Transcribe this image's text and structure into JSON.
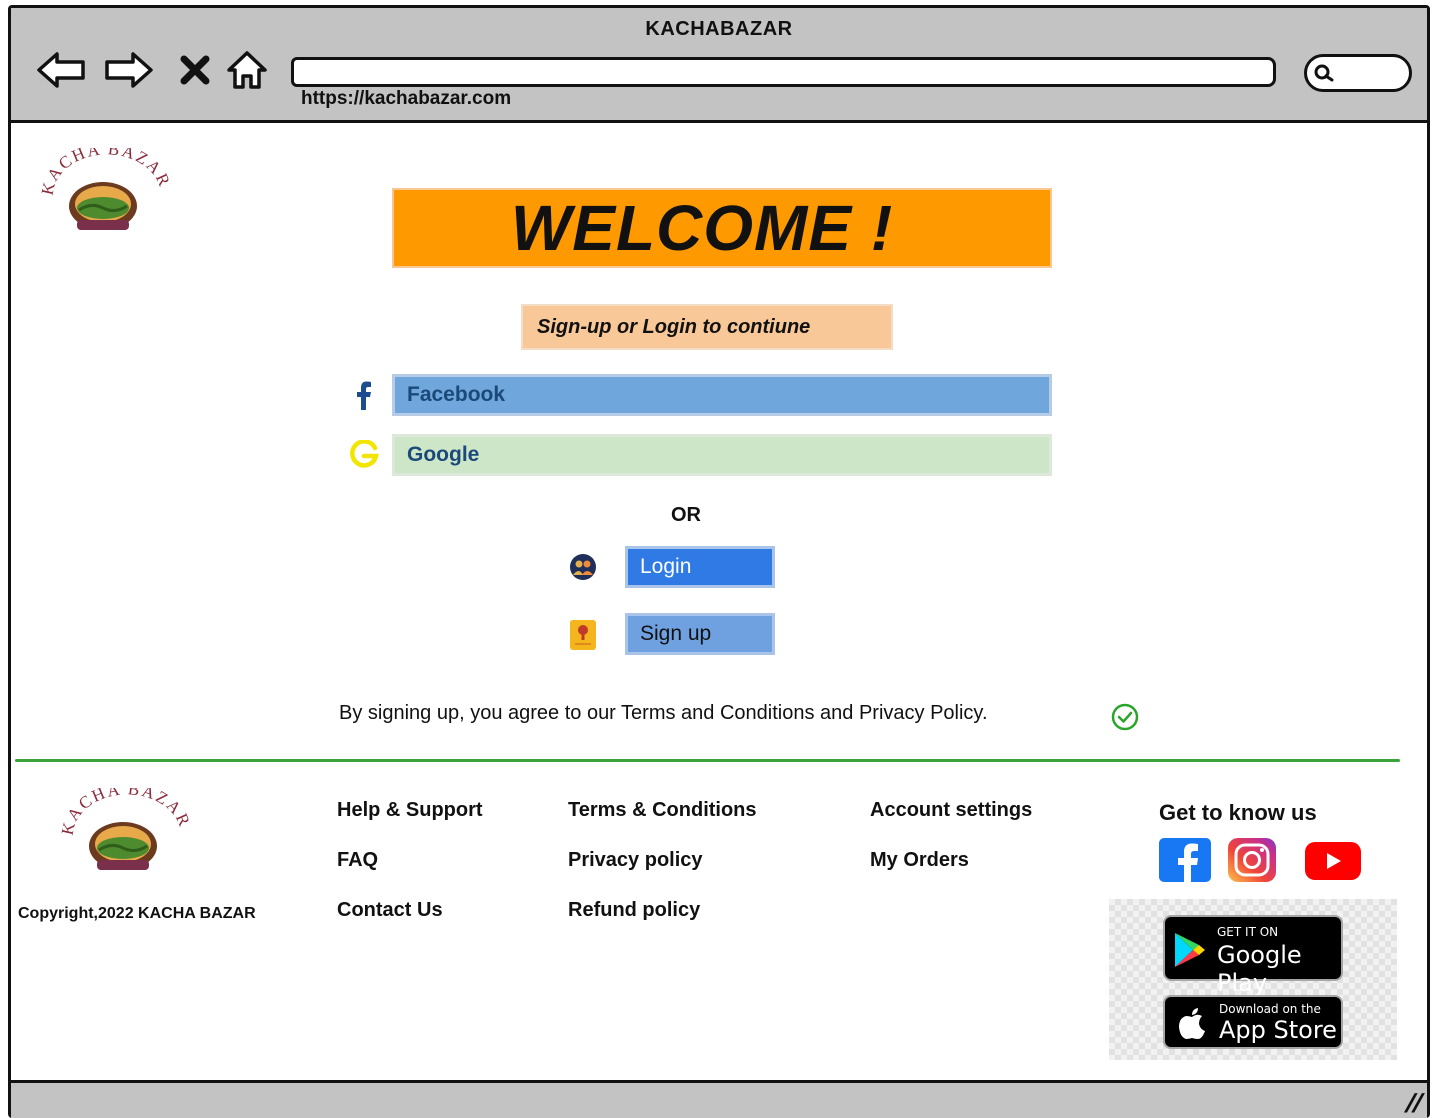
{
  "window": {
    "title": "KACHABAZAR"
  },
  "browser": {
    "url": "https://kachabazar.com",
    "icons": [
      "back-arrow-icon",
      "forward-arrow-icon",
      "close-x-icon",
      "home-icon",
      "search-icon"
    ]
  },
  "logo": {
    "text": "KACHA BAZAR"
  },
  "hero": {
    "welcome": "WELCOME !",
    "subtitle": "Sign-up or Login to contiune"
  },
  "social_login": {
    "facebook_label": "Facebook",
    "google_label": "Google"
  },
  "or_text": "OR",
  "actions": {
    "login_label": "Login",
    "signup_label": "Sign up"
  },
  "terms_text": "By signing up, you agree to our Terms and Conditions and Privacy Policy.",
  "footer": {
    "copyright": "Copyright,2022 KACHA BAZAR",
    "col1": [
      "Help  & Support",
      "FAQ",
      "Contact Us"
    ],
    "col2": [
      "Terms & Conditions",
      "Privacy policy",
      "Refund policy"
    ],
    "col3": [
      "Account settings",
      "My Orders"
    ],
    "get_to_know": "Get to know us",
    "social_icons": [
      "facebook-icon",
      "instagram-icon",
      "youtube-icon"
    ],
    "google_play": {
      "small": "GET IT ON",
      "big": "Google Play"
    },
    "app_store": {
      "small": "Download on the",
      "big": "App Store"
    }
  },
  "colors": {
    "welcome_bg": "#ff9900",
    "subtitle_bg": "#f9c899",
    "facebook_bg": "#6fa6dc",
    "google_bg": "#cde6c7",
    "login_bg": "#2f7ae5",
    "signup_bg": "#6fa0e0",
    "divider": "#3aa33a",
    "chrome": "#c3c3c3"
  }
}
